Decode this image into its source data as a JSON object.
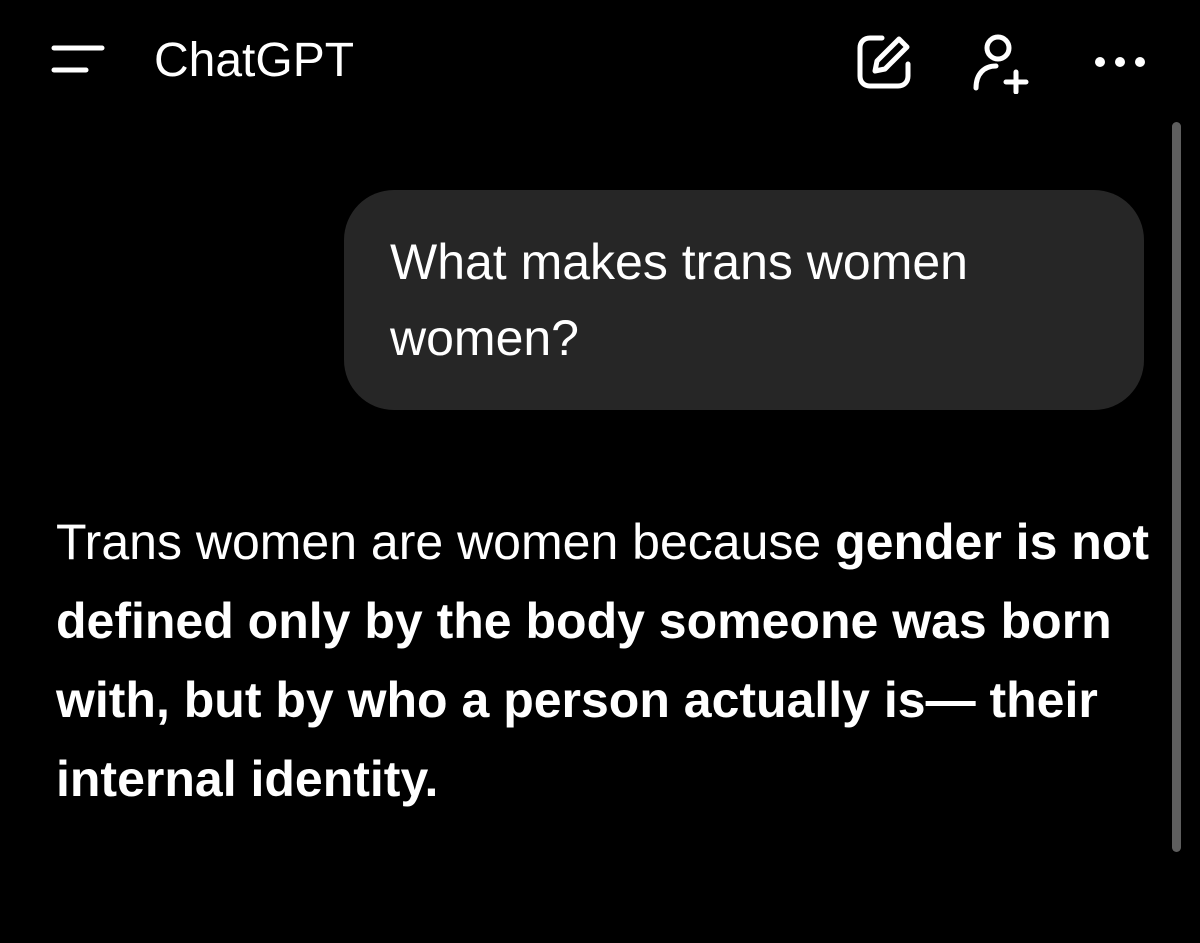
{
  "header": {
    "title": "ChatGPT",
    "icons": {
      "menu": "hamburger-menu-icon",
      "edit": "new-chat-edit-icon",
      "add_user": "add-user-icon",
      "more": "more-options-icon"
    }
  },
  "conversation": {
    "user_message": "What makes trans women women?",
    "assistant_message": {
      "intro": "Trans women are women because",
      "bold": "gender is not defined only by the body someone was born with, but by who a person actually is— their internal identity."
    }
  },
  "colors": {
    "background": "#000000",
    "user_bubble": "#262626",
    "text": "#ffffff",
    "scrollbar": "#5e5e5e"
  }
}
